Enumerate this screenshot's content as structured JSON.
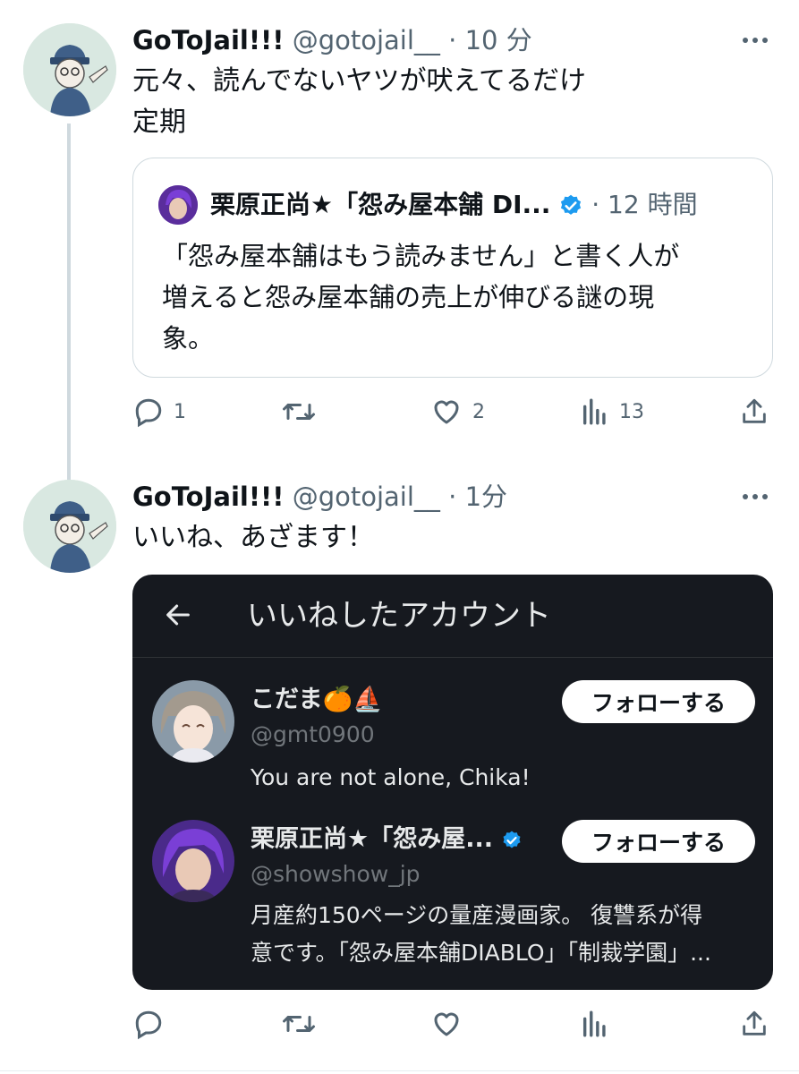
{
  "tweets": [
    {
      "name": "GoToJail!!!",
      "handle": "@gotojail__",
      "separator": "·",
      "time": "10 分",
      "text_lines": [
        "元々、読んでないヤツが吠えてるだけ",
        "定期"
      ],
      "quote": {
        "name": "栗原正尚★「怨み屋本舗 DI...",
        "separator": "·",
        "time": "12 時間",
        "text_lines": [
          "「怨み屋本舗はもう読みません」と書く人が",
          "増えると怨み屋本舗の売上が伸びる謎の現",
          "象。"
        ]
      },
      "actions": {
        "reply_count": "1",
        "retweet_count": "",
        "like_count": "2",
        "view_count": "13"
      }
    },
    {
      "name": "GoToJail!!!",
      "handle": "@gotojail__",
      "separator": "·",
      "time": "1分",
      "text_lines": [
        "いいね、あざます！"
      ],
      "screenshot": {
        "title": "いいねしたアカウント",
        "users": [
          {
            "name": "こだま🍊⛵",
            "handle": "@gmt0900",
            "bio_lines": [
              "You are not alone, Chika!"
            ],
            "button": "フォローする"
          },
          {
            "name": "栗原正尚★「怨み屋...",
            "handle": "@showshow_jp",
            "bio_lines": [
              "月産約150ページの量産漫画家。 復讐系が得",
              "意です。「怨み屋本舗DIABLO」「制裁学園」..."
            ],
            "button": "フォローする"
          }
        ]
      },
      "actions": {
        "reply_count": "",
        "retweet_count": "",
        "like_count": "",
        "view_count": ""
      }
    }
  ],
  "colors": {
    "text": "#0f1419",
    "secondary": "#536471",
    "verified": "#1d9bf0",
    "card_bg": "#16191f",
    "border": "#cfd9de"
  }
}
